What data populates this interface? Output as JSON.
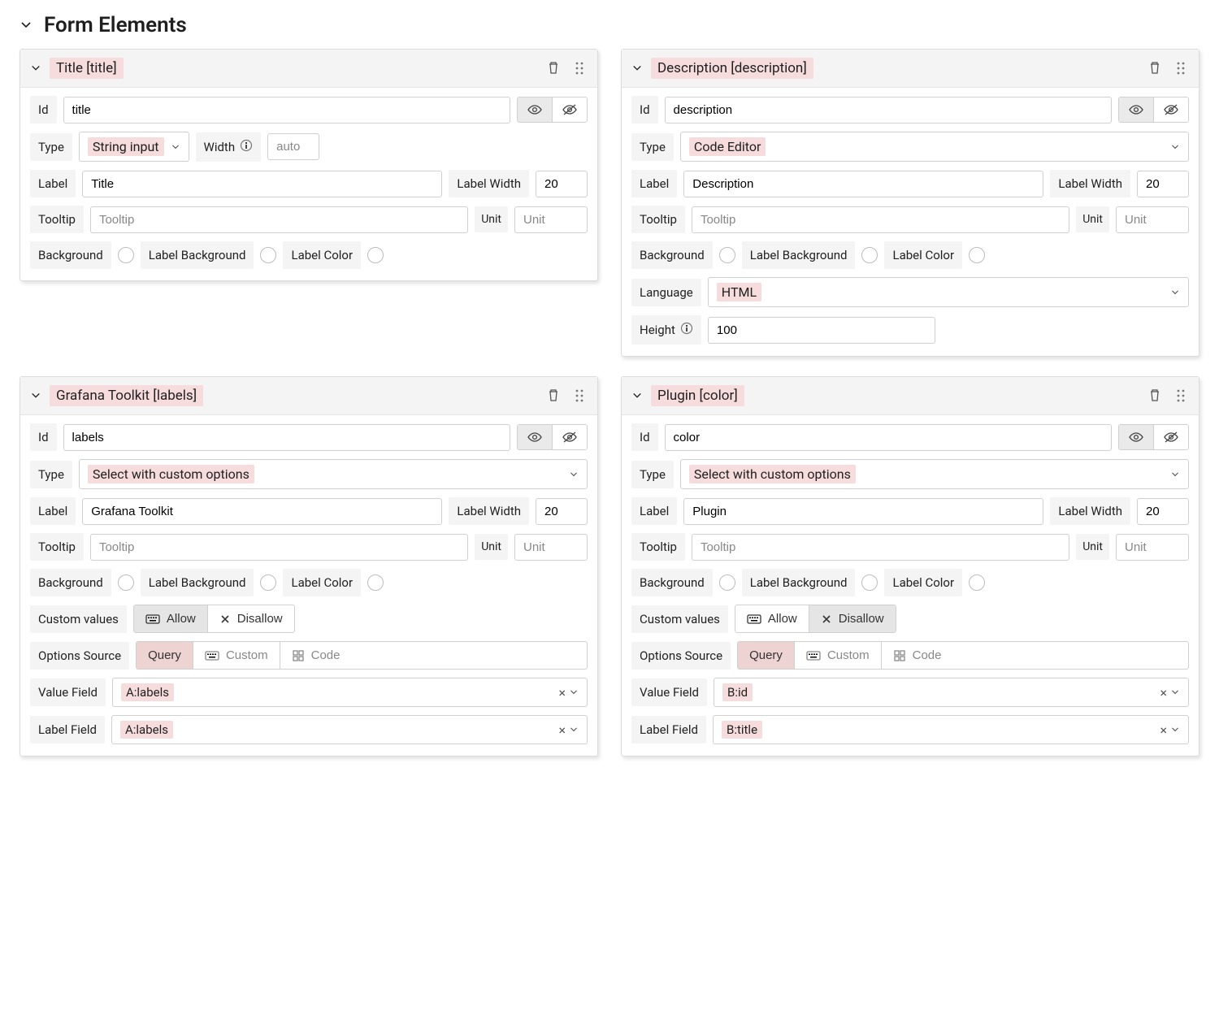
{
  "section_title": "Form Elements",
  "labels": {
    "id": "Id",
    "type": "Type",
    "width": "Width",
    "label": "Label",
    "label_width": "Label Width",
    "tooltip": "Tooltip",
    "unit": "Unit",
    "background": "Background",
    "label_background": "Label Background",
    "label_color": "Label Color",
    "language": "Language",
    "height": "Height",
    "custom_values": "Custom values",
    "options_source": "Options Source",
    "value_field": "Value Field",
    "label_field": "Label Field",
    "allow": "Allow",
    "disallow": "Disallow",
    "query": "Query",
    "custom": "Custom",
    "code": "Code"
  },
  "placeholders": {
    "tooltip": "Tooltip",
    "unit": "Unit",
    "auto": "auto"
  },
  "card_title": {
    "header": "Title [title]",
    "id": "title",
    "type": "String input",
    "label": "Title",
    "label_width": "20"
  },
  "card_description": {
    "header": "Description [description]",
    "id": "description",
    "type": "Code Editor",
    "label": "Description",
    "label_width": "20",
    "language": "HTML",
    "height": "100"
  },
  "card_labels": {
    "header": "Grafana Toolkit [labels]",
    "id": "labels",
    "type": "Select with custom options",
    "label": "Grafana Toolkit",
    "label_width": "20",
    "custom_values_active": "allow",
    "options_source_active": "query",
    "value_field": "A:labels",
    "label_field": "A:labels"
  },
  "card_color": {
    "header": "Plugin [color]",
    "id": "color",
    "type": "Select with custom options",
    "label": "Plugin",
    "label_width": "20",
    "custom_values_active": "disallow",
    "options_source_active": "query",
    "value_field": "B:id",
    "label_field": "B:title"
  }
}
